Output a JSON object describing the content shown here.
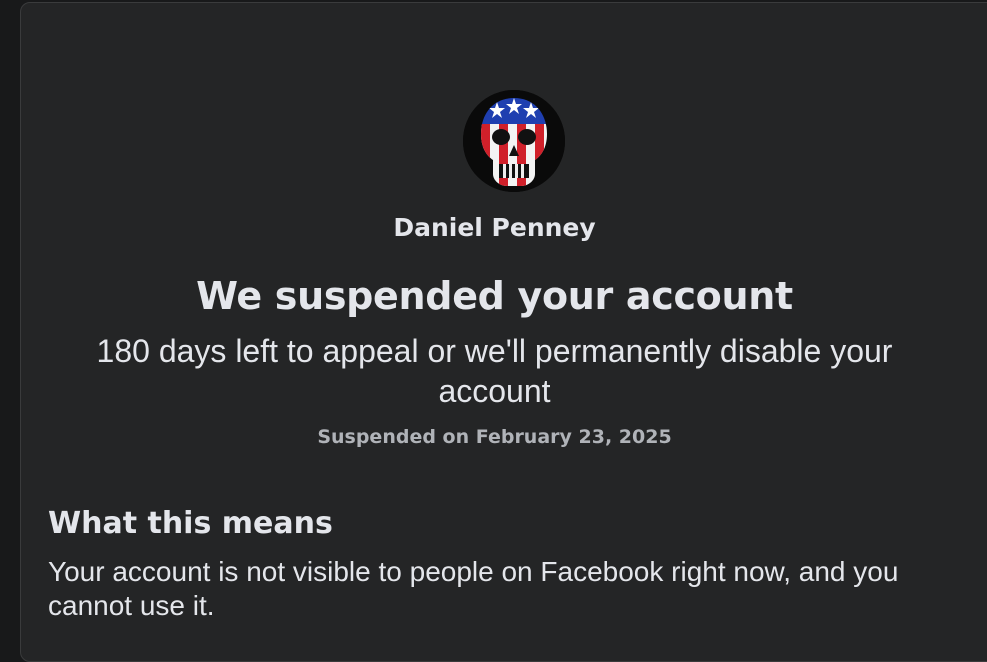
{
  "profile": {
    "name": "Daniel Penney",
    "avatar_description": "skull-flag-avatar"
  },
  "notice": {
    "title": "We suspended your account",
    "subtitle": "180 days left to appeal or we'll permanently disable your account",
    "suspended_date": "Suspended on February 23, 2025"
  },
  "section": {
    "heading": "What this means",
    "body": "Your account is not visible to people on Facebook right now, and you cannot use it."
  },
  "colors": {
    "page_background": "#18191a",
    "card_background": "#242526",
    "primary_text": "#e4e6eb",
    "secondary_text": "#b0b3b8"
  }
}
